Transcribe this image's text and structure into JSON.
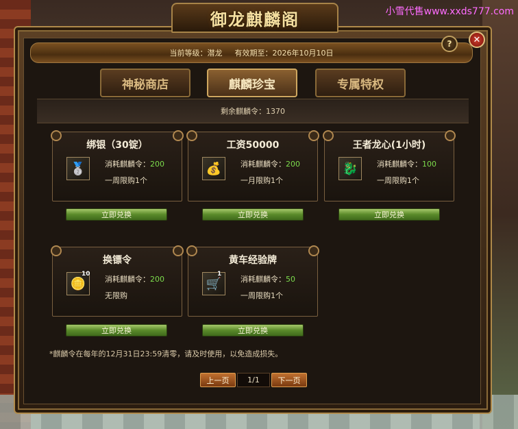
{
  "watermark": "小雪代售www.xxds777.com",
  "title": "御龙麒麟阁",
  "info": {
    "level_label": "当前等级：潜龙",
    "expire_label": "有效期至：2026年10月10日"
  },
  "buttons": {
    "help": "?",
    "close": "✕"
  },
  "tabs": [
    {
      "label": "神秘商店",
      "active": false
    },
    {
      "label": "麒麟珍宝",
      "active": true
    },
    {
      "label": "专属特权",
      "active": false
    }
  ],
  "remaining": "剩余麒麟令：1370",
  "items": [
    {
      "name": "绑银（30锭）",
      "icon": "silver-ingot-icon",
      "glyph": "🥈",
      "cost_label": "消耗麒麟令：",
      "cost": "200",
      "limit": "一周限购1个",
      "qty": "",
      "button": "立即兑换"
    },
    {
      "name": "工资50000",
      "icon": "gold-coins-icon",
      "glyph": "💰",
      "cost_label": "消耗麒麟令：",
      "cost": "200",
      "limit": "一月限购1个",
      "qty": "",
      "button": "立即兑换"
    },
    {
      "name": "王者龙心(1小时)",
      "icon": "dragon-heart-icon",
      "glyph": "🐉",
      "cost_label": "消耗麒麟令：",
      "cost": "100",
      "limit": "一周限购1个",
      "qty": "",
      "button": "立即兑换"
    },
    {
      "name": "换镖令",
      "icon": "escort-token-icon",
      "glyph": "🪙",
      "cost_label": "消耗麒麟令：",
      "cost": "200",
      "limit": "无限购",
      "qty": "10",
      "button": "立即兑换"
    },
    {
      "name": "黄车经验牌",
      "icon": "yellow-cart-icon",
      "glyph": "🛒",
      "cost_label": "消耗麒麟令：",
      "cost": "50",
      "limit": "一周限购1个",
      "qty": "1",
      "button": "立即兑换"
    }
  ],
  "note": "*麒麟令在每年的12月31日23:59清零，请及时使用，以免造成损失。",
  "pager": {
    "prev": "上一页",
    "current": "1/1",
    "next": "下一页"
  }
}
